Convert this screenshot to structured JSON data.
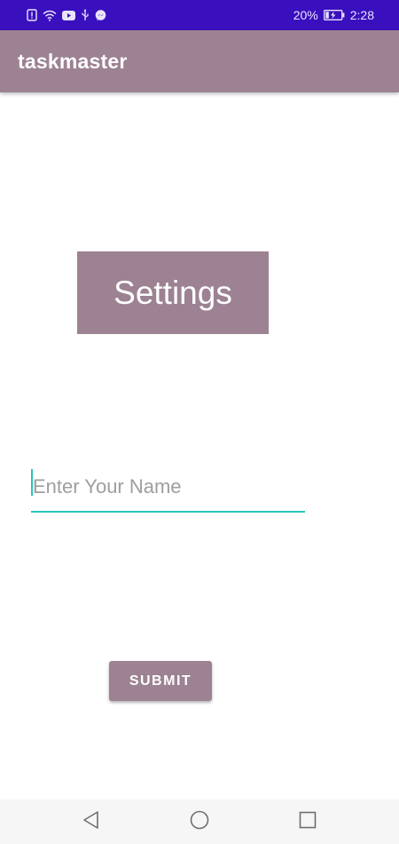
{
  "status_bar": {
    "battery_percent": "20%",
    "time": "2:28",
    "icons": [
      "alert-icon",
      "wifi-icon",
      "youtube-icon",
      "usb-icon",
      "messenger-icon",
      "battery-charging-icon"
    ],
    "background": "#3a0fbd"
  },
  "app_bar": {
    "title": "taskmaster",
    "background": "#9c8292"
  },
  "main": {
    "settings_heading": "Settings",
    "name_input": {
      "value": "",
      "placeholder": "Enter Your Name",
      "accent_color": "#26c6b8"
    },
    "submit_label": "SUBMIT"
  },
  "nav_bar": {
    "buttons": [
      "back-icon",
      "home-icon",
      "recents-icon"
    ]
  }
}
